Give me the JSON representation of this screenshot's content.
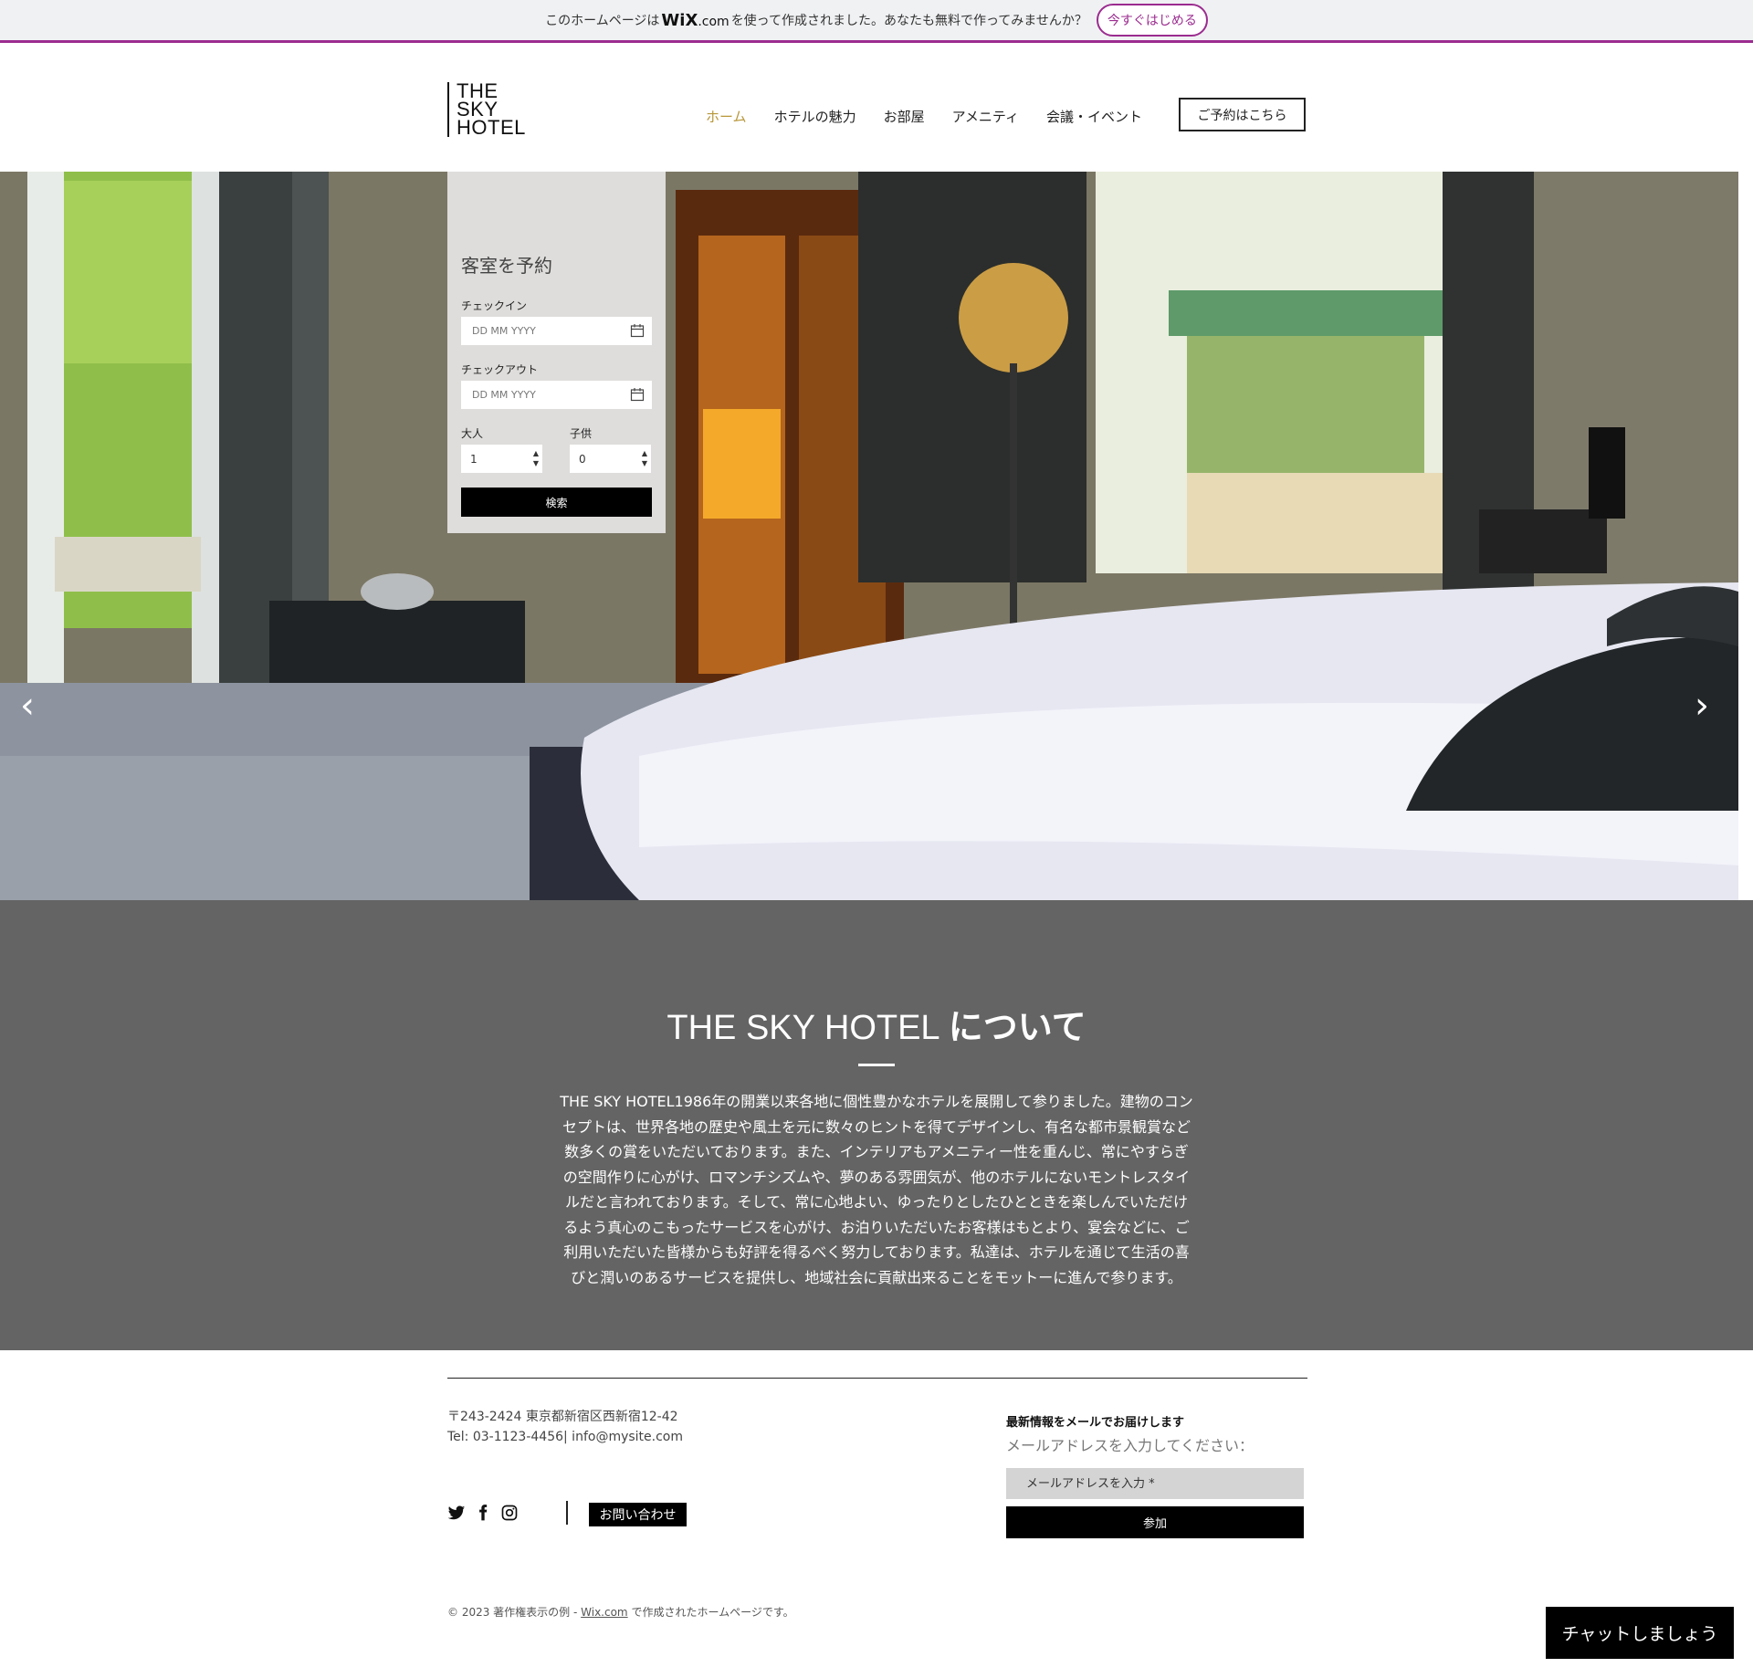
{
  "wix_banner": {
    "text_before": "このホームページは",
    "brand": "WiX",
    "brand_suffix": ".com",
    "text_after": "を使って作成されました。あなたも無料で作ってみませんか？",
    "cta": "今すぐはじめる"
  },
  "header": {
    "logo_lines": [
      "THE",
      "SKY",
      "HOTEL"
    ],
    "nav": [
      {
        "label": "ホーム",
        "active": true
      },
      {
        "label": "ホテルの魅力",
        "active": false
      },
      {
        "label": "お部屋",
        "active": false
      },
      {
        "label": "アメニティ",
        "active": false
      },
      {
        "label": "会議・イベント",
        "active": false
      }
    ],
    "reserve_button": "ご予約はこちら"
  },
  "booking": {
    "title": "客室を予約",
    "checkin_label": "チェックイン",
    "checkin_placeholder": "DD MM YYYY",
    "checkout_label": "チェックアウト",
    "checkout_placeholder": "DD MM YYYY",
    "adults_label": "大人",
    "adults_value": "1",
    "children_label": "子供",
    "children_value": "0",
    "search_button": "検索"
  },
  "hero": {
    "prev_arrow": "‹",
    "next_arrow": "›"
  },
  "about": {
    "heading_en": "THE SKY HOTEL",
    "heading_jp": "について",
    "body": "THE SKY HOTEL1986年の開業以来各地に個性豊かなホテルを展開して参りました。建物のコンセプトは、世界各地の歴史や風土を元に数々のヒントを得てデザインし、有名な都市景観賞など数多くの賞をいただいております。また、インテリアもアメニティー性を重んじ、常にやすらぎの空間作りに心がけ、ロマンチシズムや、夢のある雰囲気が、他のホテルにないモントレスタイルだと言われております。そして、常に心地よい、ゆったりとしたひとときを楽しんでいただけるよう真心のこもったサービスを心がけ、お泊りいただいたお客様はもとより、宴会などに、ご利用いただいた皆様からも好評を得るべく努力しております。私達は、ホテルを通じて生活の喜びと潤いのあるサービスを提供し、地域社会に貢献出来ることをモットーに進んで参ります。"
  },
  "footer": {
    "address": "〒243-2424 東京都新宿区西新宿12-42",
    "contact_line": "Tel: 03-1123-4456| info@mysite.com",
    "social_icons": [
      "twitter-icon",
      "facebook-icon",
      "instagram-icon"
    ],
    "contact_button": "お問い合わせ",
    "newsletter_title": "最新情報をメールでお届けします",
    "newsletter_sub": "メールアドレスを入力してください：",
    "email_placeholder": "メールアドレスを入力 *",
    "join_button": "参加",
    "copyright_prefix": "© 2023 著作権表示の例 - ",
    "copyright_link": "Wix.com",
    "copyright_suffix": " で作成されたホームページです。"
  },
  "chat": {
    "label": "チャットしましょう"
  },
  "colors": {
    "accent": "#b8973a",
    "wix_purple": "#9b2c8f",
    "about_bg": "#646464"
  }
}
